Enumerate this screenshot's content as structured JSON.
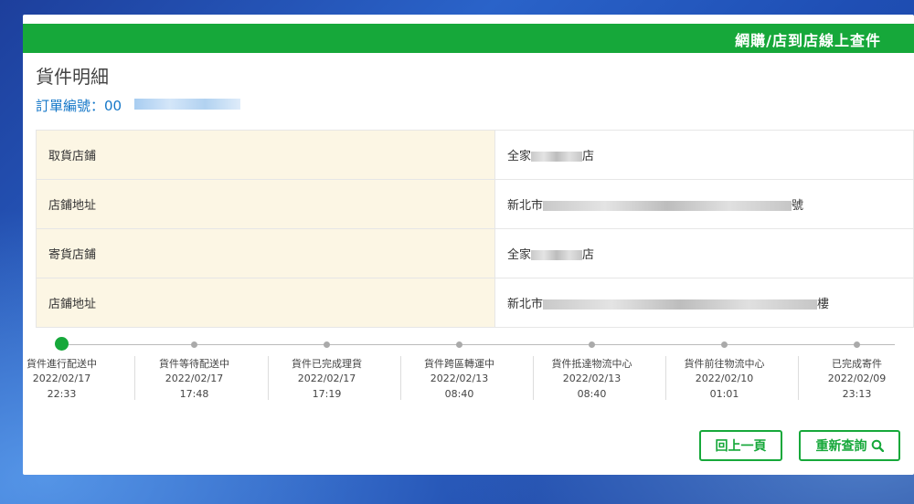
{
  "header": {
    "title": "網購/店到店線上查件"
  },
  "page": {
    "title": "貨件明細",
    "order_label": "訂單編號：00"
  },
  "info_rows": [
    {
      "label": "取貨店鋪",
      "value_prefix": "全家",
      "value_suffix": "店"
    },
    {
      "label": "店鋪地址",
      "value_prefix": "新北市",
      "value_suffix": "號"
    },
    {
      "label": "寄貨店鋪",
      "value_prefix": "全家",
      "value_suffix": "店"
    },
    {
      "label": "店鋪地址",
      "value_prefix": "新北市",
      "value_suffix": "樓"
    }
  ],
  "timeline": [
    {
      "name": "貨件進行配送中",
      "date": "2022/02/17",
      "time": "22:33",
      "active": true
    },
    {
      "name": "貨件等待配送中",
      "date": "2022/02/17",
      "time": "17:48",
      "active": false
    },
    {
      "name": "貨件已完成理貨",
      "date": "2022/02/17",
      "time": "17:19",
      "active": false
    },
    {
      "name": "貨件跨區轉運中",
      "date": "2022/02/13",
      "time": "08:40",
      "active": false
    },
    {
      "name": "貨件抵達物流中心",
      "date": "2022/02/13",
      "time": "08:40",
      "active": false
    },
    {
      "name": "貨件前往物流中心",
      "date": "2022/02/10",
      "time": "01:01",
      "active": false
    },
    {
      "name": "已完成寄件",
      "date": "2022/02/09",
      "time": "23:13",
      "active": false
    }
  ],
  "buttons": {
    "back_label": "回上一頁",
    "search_label": "重新查詢",
    "search_icon": "search-icon"
  },
  "colors": {
    "accent": "#16a83a",
    "link": "#1577c8",
    "label_bg": "#fcf6e4"
  }
}
